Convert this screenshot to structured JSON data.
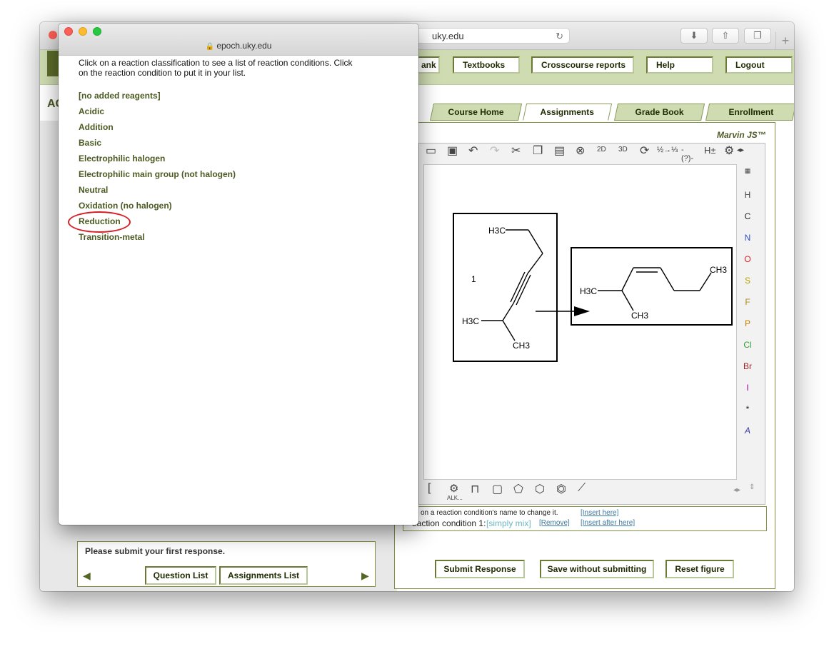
{
  "browser": {
    "address": "uky.edu",
    "popup_address": "epoch.uky.edu",
    "new_tab": "+"
  },
  "header": {
    "course_title_partial": "AC",
    "nav": [
      "ank",
      "Textbooks",
      "Crosscourse reports",
      "Help",
      "Logout"
    ],
    "tabs": [
      "Course Home",
      "Assignments",
      "Grade Book",
      "Enrollment"
    ],
    "active_tab": "Assignments"
  },
  "marvin": {
    "label": "Marvin JS™",
    "elements": [
      "H",
      "C",
      "N",
      "O",
      "S",
      "F",
      "P",
      "Cl",
      "Br",
      "I",
      "*",
      "A"
    ],
    "element_colors": {
      "H": "#444444",
      "C": "#222222",
      "N": "#3050c8",
      "O": "#e02020",
      "S": "#b8a000",
      "F": "#b08820",
      "P": "#c08000",
      "Cl": "#30a030",
      "Br": "#a02828",
      "I": "#940094",
      "*": "#222222",
      "A": "#3a3aa8"
    },
    "toolbar_labels": {
      "clean2d": "2D",
      "clean3d": "3D",
      "hpm": "H±",
      "alk": "ALK..."
    },
    "molecules": {
      "reactant_number": "1",
      "reactant_labels": [
        "H3C",
        "H3C",
        "CH3"
      ],
      "product_labels": [
        "H3C",
        "CH3",
        "CH3"
      ]
    }
  },
  "conditions": {
    "hint": "on a reaction condition's name to change it.",
    "condition_label": "eaction condition 1:",
    "condition_value": "[simply mix]",
    "remove": "[Remove]",
    "insert_here": "[Insert here]",
    "insert_after_here": "[Insert after here]"
  },
  "actions": {
    "submit": "Submit Response",
    "save": "Save without submitting",
    "reset": "Reset figure"
  },
  "status": {
    "message": "Please submit your first response.",
    "question_list": "Question List",
    "assignments_list": "Assignments List"
  },
  "popup": {
    "instructions": "Click on a reaction classification to see a list of reaction conditions. Click on the reaction condition to put it in your list.",
    "classifications": [
      "[no added reagents]",
      "Acidic",
      "Addition",
      "Basic",
      "Electrophilic halogen",
      "Electrophilic main group (not halogen)",
      "Neutral",
      "Oxidation (no halogen)",
      "Reduction",
      "Transition-metal"
    ],
    "highlighted": "Reduction"
  },
  "colors": {
    "header_green": "#cfdcb2",
    "dark_olive": "#4b5a22",
    "highlight_red": "#d81e24",
    "link_blue": "#3a7aa0"
  }
}
